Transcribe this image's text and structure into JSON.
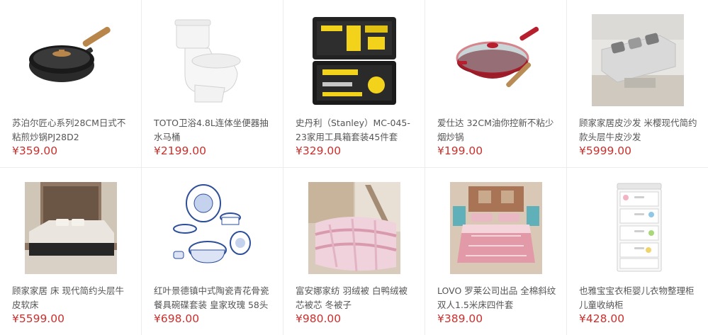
{
  "products": [
    {
      "name": "苏泊尔匠心系列28CM日式不粘煎炒锅PJ28D2",
      "price": "¥359.00",
      "icon": "wok-pan-icon"
    },
    {
      "name": "TOTO卫浴4.8L连体坐便器抽水马桶",
      "price": "¥2199.00",
      "icon": "toilet-icon"
    },
    {
      "name": "史丹利（Stanley）MC-045-23家用工具箱套装45件套",
      "price": "¥329.00",
      "icon": "toolbox-icon"
    },
    {
      "name": "爱仕达 32CM油你控新不粘少烟炒锅",
      "price": "¥199.00",
      "icon": "wok-lid-icon"
    },
    {
      "name": "顾家家居皮沙发 米樱现代简约款头层牛皮沙发",
      "price": "¥5999.00",
      "icon": "sofa-icon"
    },
    {
      "name": "顾家家居 床 现代简约头层牛皮软床",
      "price": "¥5599.00",
      "icon": "bed-icon"
    },
    {
      "name": "红叶景德镇中式陶瓷青花骨瓷餐具碗碟套装 皇家玫瑰 58头",
      "price": "¥698.00",
      "icon": "porcelain-set-icon"
    },
    {
      "name": "富安娜家纺 羽绒被 白鸭绒被芯被芯 冬被子",
      "price": "¥980.00",
      "icon": "quilt-icon"
    },
    {
      "name": "LOVO 罗莱公司出品 全棉斜纹双人1.5米床四件套",
      "price": "¥389.00",
      "icon": "bedding-set-icon"
    },
    {
      "name": "也雅宝宝衣柜婴儿衣物整理柜儿童收纳柜",
      "price": "¥428.00",
      "icon": "storage-cabinet-icon"
    }
  ]
}
